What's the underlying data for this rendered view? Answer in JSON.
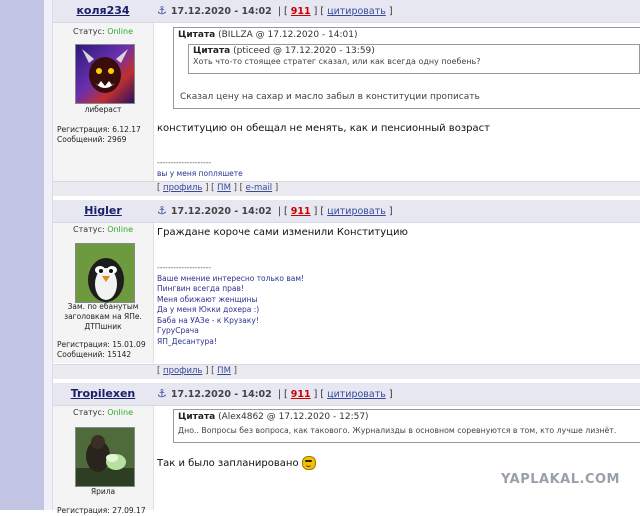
{
  "colors": {
    "link": "#3a4a9a",
    "post_number": "#cc0000",
    "online": "#2eaa2e",
    "header_bg": "#e6e7f1",
    "left_bar": "#c2c6e4"
  },
  "watermark": "YAPLAKAL.COM",
  "posts": [
    {
      "author": "коля234",
      "status_label": "Статус:",
      "status_value": "Online",
      "user_title": "либераст",
      "reg_line": "Регистрация: 6.12.17",
      "msgs_line": "Сообщений: 2969",
      "date": "17.12.2020 - 14:02",
      "post_number": "911",
      "quote_label": "цитировать",
      "quote_outer": {
        "label": "Цитата",
        "source": "(BILLZA @ 17.12.2020 - 14:01)",
        "text": "Сказал цену на сахар и масло забыл в конституции прописать"
      },
      "quote_inner": {
        "label": "Цитата",
        "source": "(pticeed @ 17.12.2020 - 13:59)",
        "text": "Хоть что-то стоящее стратег сказал, или как всегда одну поебень?"
      },
      "message": "конституцию он обещал не менять, как и пенсионный возраст",
      "sig_line": "--------------------",
      "signature": [
        "вы у меня попляшете"
      ],
      "footer": [
        "профиль",
        "ПМ",
        "e-mail"
      ]
    },
    {
      "author": "Higler",
      "status_label": "Статус:",
      "status_value": "Online",
      "user_title": "Зам. по ебанутым заголовкам на ЯПе. ДТПшник",
      "reg_line": "Регистрация: 15.01.09",
      "msgs_line": "Сообщений: 15142",
      "date": "17.12.2020 - 14:02",
      "post_number": "911",
      "quote_label": "цитировать",
      "message": "Граждане короче сами изменили Конституцию",
      "sig_line": "--------------------",
      "signature": [
        "Ваше мнение интересно только вам!",
        "Пингвин всегда прав!",
        "Меня обижают женщины",
        "Да у меня Юкки дохера :)",
        "Баба на УАЗе - к Крузаку!",
        "ГуруСрача",
        "ЯП_Десантура!"
      ],
      "footer": [
        "профиль",
        "ПМ"
      ]
    },
    {
      "author": "Tropilexen",
      "status_label": "Статус:",
      "status_value": "Online",
      "user_title": "Ярила",
      "reg_line": "Регистрация: 27.09.17",
      "date": "17.12.2020 - 14:02",
      "post_number": "911",
      "quote_label": "цитировать",
      "quote_outer": {
        "label": "Цитата",
        "source": "(Alex4862 @ 17.12.2020 - 12:57)",
        "text": "Дно.. Вопросы без вопроса, как такового. Журнализды в основном соревнуются в том, кто лучше лизнёт."
      },
      "message": "Так и было запланировано",
      "emoji": "cool-smiley-icon"
    }
  ]
}
